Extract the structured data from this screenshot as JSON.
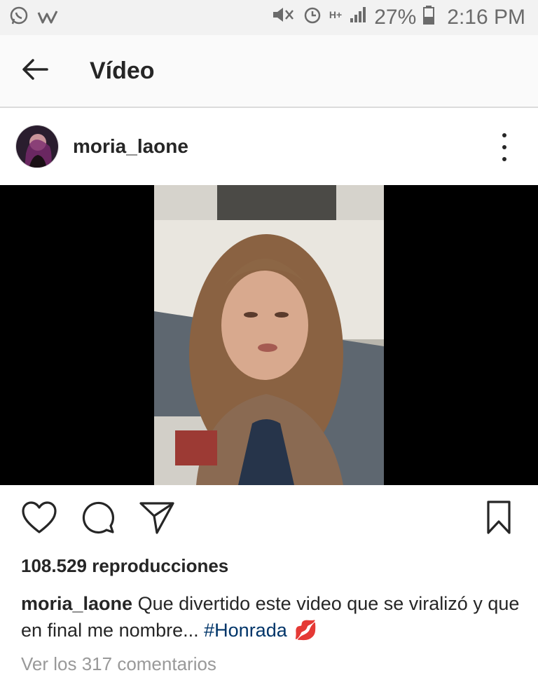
{
  "status_bar": {
    "battery_percent": "27%",
    "time": "2:16 PM",
    "network": "H+",
    "icons": [
      "whatsapp-icon",
      "wattpad-icon",
      "mute-icon",
      "alarm-icon",
      "signal-icon",
      "battery-icon"
    ]
  },
  "app_bar": {
    "title": "Vídeo",
    "back_icon": "arrow-left-icon"
  },
  "post": {
    "username": "moria_laone",
    "more_icon": "more-vertical-icon",
    "actions": [
      "heart-icon",
      "comment-icon",
      "share-icon",
      "bookmark-icon"
    ],
    "views": "108.529 reproducciones",
    "caption_user": "moria_laone",
    "caption_text": " Que divertido este video que se viralizó y que en final me nombre... ",
    "caption_hashtag": "#Honrada",
    "caption_emoji": "💋",
    "comments_link": "Ver los 317 comentarios"
  },
  "colors": {
    "status_bar_bg": "#f2f2f2",
    "app_bar_bg": "#fafafa",
    "text": "#262626",
    "muted": "#999999",
    "hashtag": "#003569"
  }
}
